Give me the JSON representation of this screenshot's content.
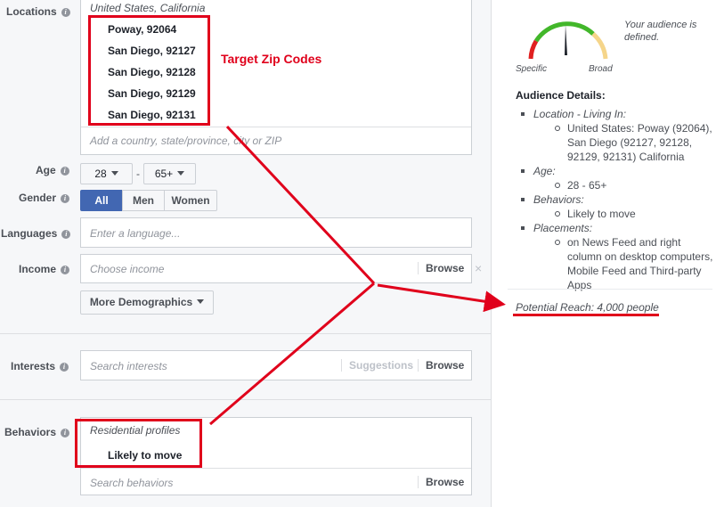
{
  "locations": {
    "label": "Locations",
    "country_header": "United States, California",
    "zips": [
      "Poway, 92064",
      "San Diego, 92127",
      "San Diego, 92128",
      "San Diego, 92129",
      "San Diego, 92131"
    ],
    "placeholder": "Add a country, state/province, city or ZIP"
  },
  "annotation": {
    "target_zip": "Target Zip Codes"
  },
  "age": {
    "label": "Age",
    "min": "28",
    "dash": "-",
    "max": "65+"
  },
  "gender": {
    "label": "Gender",
    "options": [
      "All",
      "Men",
      "Women"
    ],
    "selected": "All"
  },
  "languages": {
    "label": "Languages",
    "placeholder": "Enter a language..."
  },
  "income": {
    "label": "Income",
    "placeholder": "Choose income",
    "browse": "Browse",
    "clear": "×"
  },
  "more_demographics": {
    "label": "More Demographics"
  },
  "interests": {
    "label": "Interests",
    "placeholder": "Search interests",
    "suggestions": "Suggestions",
    "browse": "Browse"
  },
  "behaviors": {
    "label": "Behaviors",
    "category": "Residential profiles",
    "item": "Likely to move",
    "placeholder": "Search behaviors",
    "browse": "Browse"
  },
  "gauge": {
    "specific": "Specific",
    "broad": "Broad",
    "status": "Your audience is defined."
  },
  "audience": {
    "title": "Audience Details:",
    "location_label": "Location - Living In:",
    "location_value": "United States: Poway (92064), San Diego (92127, 92128, 92129, 92131) California",
    "age_label": "Age:",
    "age_value": "28 - 65+",
    "behaviors_label": "Behaviors:",
    "behaviors_value": "Likely to move",
    "placements_label": "Placements:",
    "placements_value": "on News Feed and right column on desktop computers, Mobile Feed and Third-party Apps"
  },
  "reach": {
    "text": "Potential Reach: 4,000 people"
  },
  "colors": {
    "annotation_red": "#e0001b",
    "selected_blue": "#4267b2",
    "gauge_green": "#42b72a",
    "gauge_red": "#e02020",
    "gauge_yellow": "#f5d58a"
  }
}
